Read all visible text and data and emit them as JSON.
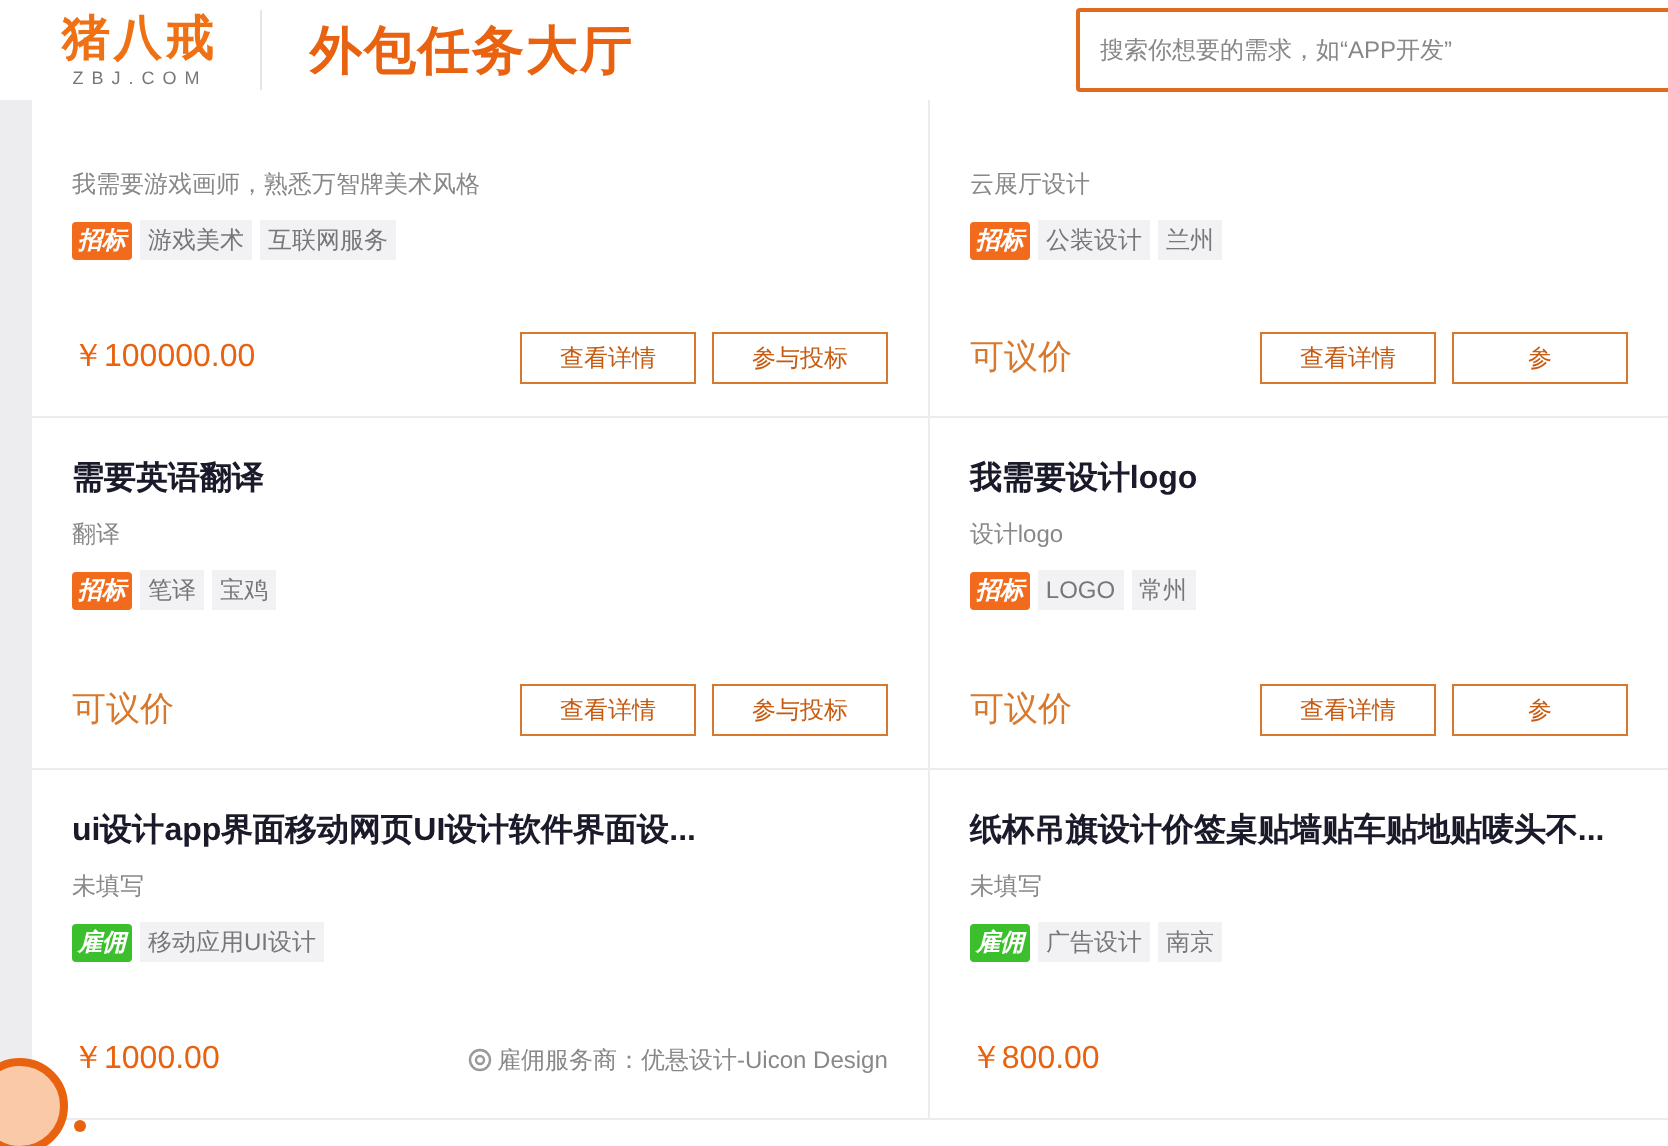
{
  "header": {
    "logo": "猪八戒",
    "logo_domain": "ZBJ.COM",
    "title": "外包任务大厅",
    "search": {
      "placeholder": "搜索你想要的需求，如“APP开发”"
    }
  },
  "rows": [
    [
      {
        "desc": "我需要游戏画师，熟悉万智牌美术风格",
        "badge": {
          "kind": "bid",
          "label": "招标"
        },
        "tags": [
          "游戏美术",
          "互联网服务"
        ],
        "price": {
          "kind": "amount",
          "text": "￥100000.00"
        },
        "buttons": [
          "查看详情",
          "参与投标"
        ]
      },
      {
        "desc": "云展厅设计",
        "badge": {
          "kind": "bid",
          "label": "招标"
        },
        "tags": [
          "公装设计",
          "兰州"
        ],
        "price": {
          "kind": "negotiable",
          "text": "可议价"
        },
        "buttons": [
          "查看详情",
          "参"
        ]
      }
    ],
    [
      {
        "title": "需要英语翻译",
        "desc": "翻译",
        "badge": {
          "kind": "bid",
          "label": "招标"
        },
        "tags": [
          "笔译",
          "宝鸡"
        ],
        "price": {
          "kind": "negotiable",
          "text": "可议价"
        },
        "buttons": [
          "查看详情",
          "参与投标"
        ]
      },
      {
        "title": "我需要设计logo",
        "desc": "设计logo",
        "badge": {
          "kind": "bid",
          "label": "招标"
        },
        "tags": [
          "LOGO",
          "常州"
        ],
        "price": {
          "kind": "negotiable",
          "text": "可议价"
        },
        "buttons": [
          "查看详情",
          "参"
        ]
      }
    ],
    [
      {
        "title": "ui设计app界面移动网页UI设计软件界面设...",
        "desc": "未填写",
        "badge": {
          "kind": "hire",
          "label": "雇佣"
        },
        "tags": [
          "移动应用UI设计"
        ],
        "price": {
          "kind": "amount",
          "text": "￥1000.00"
        },
        "provider": "雇佣服务商：优悬设计-Uicon Design"
      },
      {
        "title": "纸杯吊旗设计价签桌贴墙贴车贴地贴唛头不...",
        "desc": "未填写",
        "badge": {
          "kind": "hire",
          "label": "雇佣"
        },
        "tags": [
          "广告设计",
          "南京"
        ],
        "price": {
          "kind": "amount",
          "text": "￥800.00"
        }
      }
    ]
  ]
}
